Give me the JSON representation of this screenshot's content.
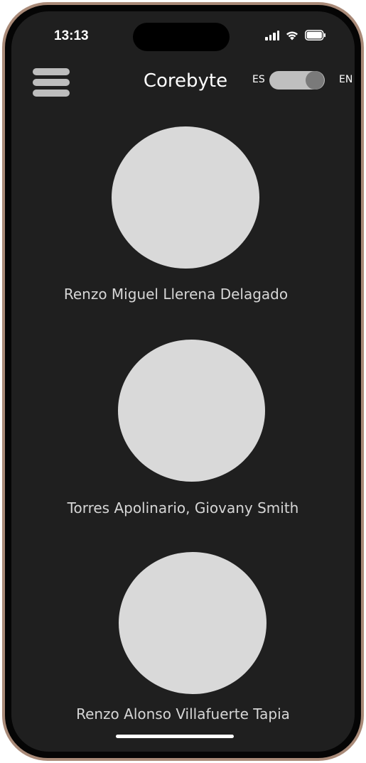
{
  "status_bar": {
    "time": "13:13",
    "icons": [
      "signal-icon",
      "wifi-icon",
      "battery-icon"
    ]
  },
  "header": {
    "menu_icon": "hamburger-menu-icon",
    "title": "Corebyte",
    "lang_left": "ES",
    "lang_right": "EN",
    "toggle_state": "EN"
  },
  "team": [
    {
      "name": "Renzo Miguel Llerena Delagado"
    },
    {
      "name": "Torres Apolinario, Giovany Smith"
    },
    {
      "name": "Renzo Alonso Villafuerte Tapia"
    }
  ],
  "colors": {
    "background": "#1f1f1f",
    "frame": "#a98a78",
    "avatar": "#d9d9d9",
    "toggle_track": "#bfbfbf",
    "toggle_knob": "#7a7a7a",
    "text": "#ffffff"
  }
}
